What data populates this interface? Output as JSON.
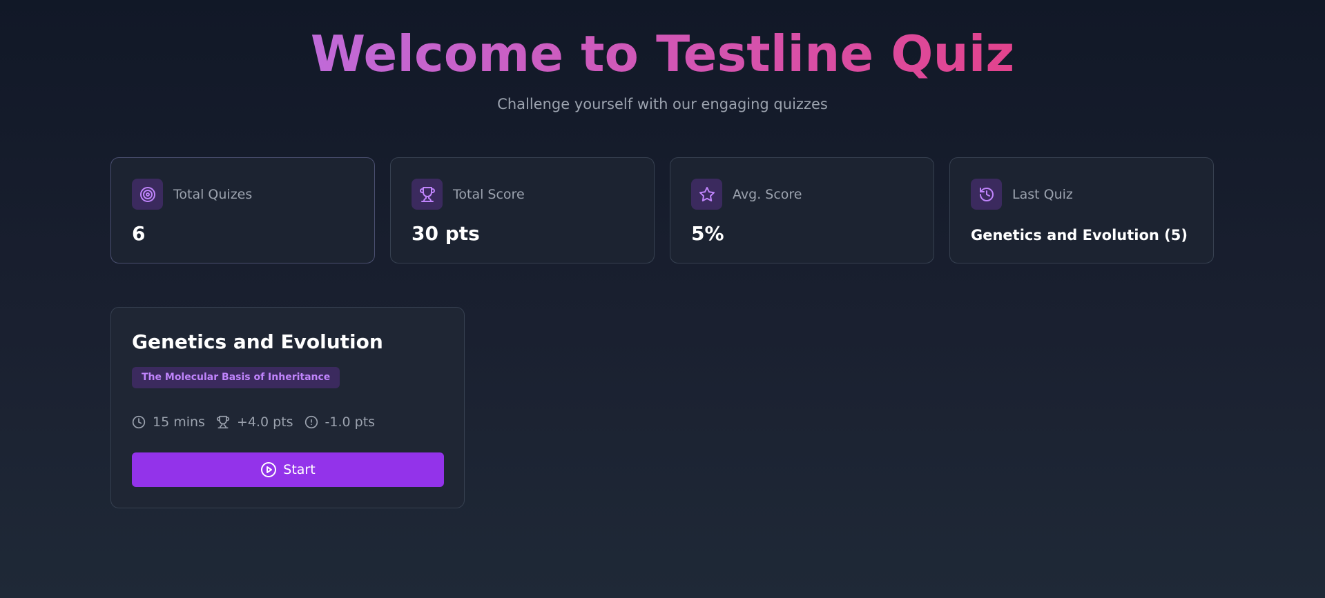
{
  "hero": {
    "title": "Welcome to Testline Quiz",
    "subtitle": "Challenge yourself with our engaging quizzes"
  },
  "stats": [
    {
      "icon": "target-icon",
      "label": "Total Quizes",
      "value": "6"
    },
    {
      "icon": "trophy-icon",
      "label": "Total Score",
      "value": "30 pts"
    },
    {
      "icon": "star-icon",
      "label": "Avg. Score",
      "value": "5%"
    },
    {
      "icon": "history-icon",
      "label": "Last Quiz",
      "value": "Genetics and Evolution (5)"
    }
  ],
  "quiz": {
    "title": "Genetics and Evolution",
    "tag": "The Molecular Basis of Inheritance",
    "duration": "15 mins",
    "correct_points": "+4.0 pts",
    "negative_points": "-1.0 pts",
    "start_label": "Start"
  },
  "colors": {
    "accent": "#9333ea",
    "title_gradient_start": "#c06ad8",
    "title_gradient_end": "#e2438d",
    "icon_tile": "#3b2a5e",
    "icon_stroke": "#c084fc"
  }
}
